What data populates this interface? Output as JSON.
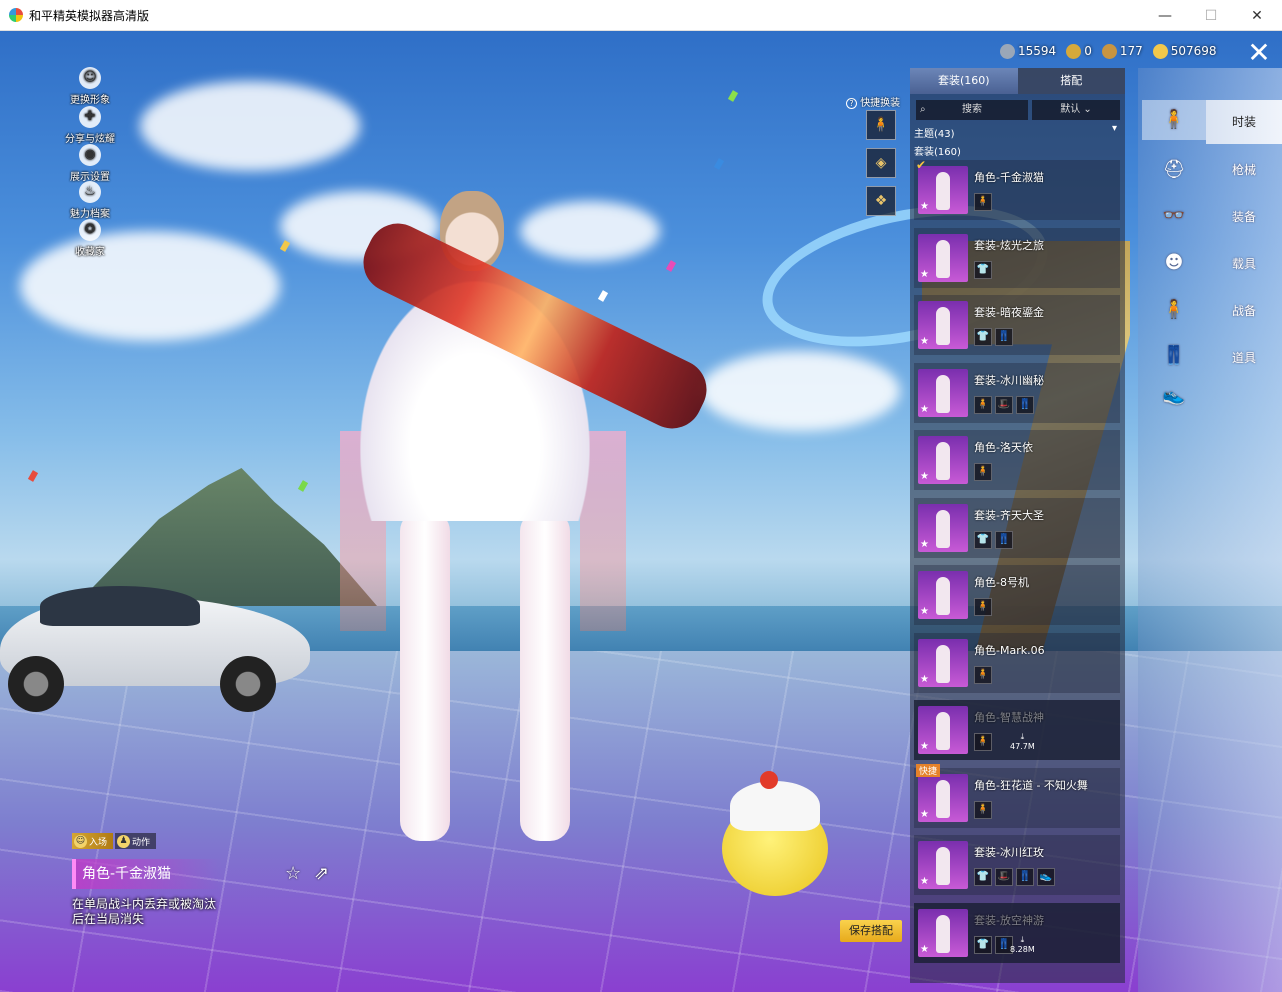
{
  "window": {
    "title": "和平精英模拟器高清版",
    "controls": {
      "minimize": "—",
      "maximize": "☐",
      "close": "✕"
    }
  },
  "left_menu": [
    {
      "label": "更换形象",
      "icon": "person-icon"
    },
    {
      "label": "分享与炫耀",
      "icon": "share-gear-icon"
    },
    {
      "label": "展示设置",
      "icon": "eye-icon"
    },
    {
      "label": "魅力档案",
      "icon": "flame-icon"
    },
    {
      "label": "收藏家",
      "icon": "collector-badge-icon"
    }
  ],
  "currency": [
    {
      "value": "15594",
      "icon": "gem-coin-icon",
      "color": "#9aa7b8"
    },
    {
      "value": "0",
      "icon": "a-coin-icon",
      "color": "#d7a93a"
    },
    {
      "value": "177",
      "icon": "badge-coin-icon",
      "color": "#c89542"
    },
    {
      "value": "507698",
      "icon": "gold-coin-icon",
      "color": "#f2c84b"
    }
  ],
  "close_label": "✕",
  "quick_change": {
    "label": "快捷换装",
    "help_icon": "?",
    "slots": [
      "🧍",
      "◈",
      "❖"
    ]
  },
  "panel": {
    "tabs": [
      "套装(160)",
      "搭配"
    ],
    "active_tab": 0,
    "search_placeholder": "搜索",
    "sort_label": "默认",
    "theme_label": "主题(43)",
    "set_label": "套装(160)",
    "outfits": [
      {
        "name": "角色-千金淑猫",
        "parts": [
          "🧍"
        ],
        "selected": true,
        "badge": "",
        "size": "",
        "dim": false
      },
      {
        "name": "套装-炫光之旅",
        "parts": [
          "👕"
        ],
        "selected": false,
        "badge": "",
        "size": "",
        "dim": false
      },
      {
        "name": "套装-暗夜鎏金",
        "parts": [
          "👕",
          "👖"
        ],
        "selected": false,
        "badge": "",
        "size": "",
        "dim": false
      },
      {
        "name": "套装-冰川幽秘",
        "parts": [
          "🧍",
          "🎩",
          "👖"
        ],
        "selected": false,
        "badge": "",
        "size": "",
        "dim": false
      },
      {
        "name": "角色-洛天依",
        "parts": [
          "🧍"
        ],
        "selected": false,
        "badge": "",
        "size": "",
        "dim": false
      },
      {
        "name": "套装-齐天大圣",
        "parts": [
          "👕",
          "👖"
        ],
        "selected": false,
        "badge": "",
        "size": "",
        "dim": false
      },
      {
        "name": "角色-8号机",
        "parts": [
          "🧍"
        ],
        "selected": false,
        "badge": "",
        "size": "",
        "dim": false
      },
      {
        "name": "角色-Mark.06",
        "parts": [
          "🧍"
        ],
        "selected": false,
        "badge": "",
        "size": "",
        "dim": false
      },
      {
        "name": "角色-智慧战神",
        "parts": [
          "🧍"
        ],
        "selected": false,
        "badge": "",
        "size": "47.7M",
        "dim": true
      },
      {
        "name": "角色-狂花道 - 不知火舞",
        "parts": [
          "🧍"
        ],
        "selected": false,
        "badge": "快捷",
        "size": "",
        "dim": false
      },
      {
        "name": "套装-冰川红玫",
        "parts": [
          "👕",
          "🎩",
          "👖",
          "👟"
        ],
        "selected": false,
        "badge": "",
        "size": "",
        "dim": false
      },
      {
        "name": "套装-放空神游",
        "parts": [
          "👕",
          "👖"
        ],
        "selected": false,
        "badge": "",
        "size": "8.28M",
        "dim": true
      }
    ]
  },
  "categories": [
    {
      "label": "时装",
      "icon": "body-icon",
      "active": true
    },
    {
      "label": "枪械",
      "icon": "helmet-icon",
      "active": false
    },
    {
      "label": "装备",
      "icon": "goggles-icon",
      "active": false
    },
    {
      "label": "载具",
      "icon": "mask-icon",
      "active": false
    },
    {
      "label": "战备",
      "icon": "outfit-icon",
      "active": false
    },
    {
      "label": "道具",
      "icon": "pants-icon",
      "active": false
    }
  ],
  "category_extra_icons": [
    "shoes-icon"
  ],
  "mode_tabs": [
    {
      "label": "入场",
      "active": true
    },
    {
      "label": "动作",
      "active": false
    }
  ],
  "character_name": "角色-千金淑猫",
  "character_desc": "在单局战斗内丢弃或被淘汰后在当局消失",
  "save_button": "保存搭配",
  "star_icon": "☆",
  "share_icon": "⇗"
}
